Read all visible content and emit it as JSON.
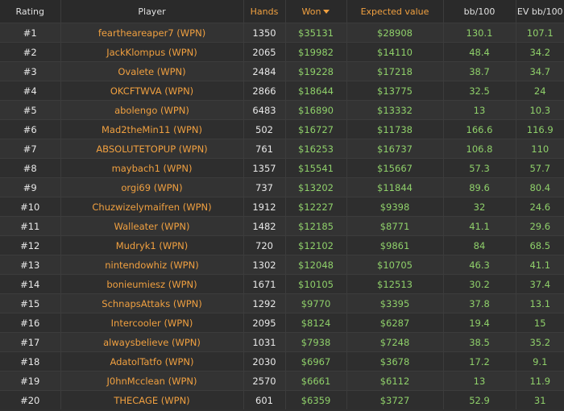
{
  "headers": {
    "rating": "Rating",
    "player": "Player",
    "hands": "Hands",
    "won": "Won",
    "expected": "Expected value",
    "bb100": "bb/100",
    "evbb100": "EV bb/100"
  },
  "colors": {
    "accent": "#f0a040",
    "positive": "#8fd06a",
    "background": "#303030"
  },
  "sort": {
    "column": "won",
    "direction": "desc",
    "icon": "caret-down-icon"
  },
  "rows": [
    {
      "rating": "#1",
      "player": "feartheareaper7 (WPN)",
      "hands": "1350",
      "won": "$35131",
      "expected": "$28908",
      "bb100": "130.1",
      "evbb100": "107.1"
    },
    {
      "rating": "#2",
      "player": "JackKlompus (WPN)",
      "hands": "2065",
      "won": "$19982",
      "expected": "$14110",
      "bb100": "48.4",
      "evbb100": "34.2"
    },
    {
      "rating": "#3",
      "player": "Ovalete (WPN)",
      "hands": "2484",
      "won": "$19228",
      "expected": "$17218",
      "bb100": "38.7",
      "evbb100": "34.7"
    },
    {
      "rating": "#4",
      "player": "OKCFTWVA (WPN)",
      "hands": "2866",
      "won": "$18644",
      "expected": "$13775",
      "bb100": "32.5",
      "evbb100": "24"
    },
    {
      "rating": "#5",
      "player": "abolengo (WPN)",
      "hands": "6483",
      "won": "$16890",
      "expected": "$13332",
      "bb100": "13",
      "evbb100": "10.3"
    },
    {
      "rating": "#6",
      "player": "Mad2theMin11 (WPN)",
      "hands": "502",
      "won": "$16727",
      "expected": "$11738",
      "bb100": "166.6",
      "evbb100": "116.9"
    },
    {
      "rating": "#7",
      "player": "ABSOLUTETOPUP (WPN)",
      "hands": "761",
      "won": "$16253",
      "expected": "$16737",
      "bb100": "106.8",
      "evbb100": "110"
    },
    {
      "rating": "#8",
      "player": "maybach1 (WPN)",
      "hands": "1357",
      "won": "$15541",
      "expected": "$15667",
      "bb100": "57.3",
      "evbb100": "57.7"
    },
    {
      "rating": "#9",
      "player": "orgi69 (WPN)",
      "hands": "737",
      "won": "$13202",
      "expected": "$11844",
      "bb100": "89.6",
      "evbb100": "80.4"
    },
    {
      "rating": "#10",
      "player": "Chuzwizelymaifren (WPN)",
      "hands": "1912",
      "won": "$12227",
      "expected": "$9398",
      "bb100": "32",
      "evbb100": "24.6"
    },
    {
      "rating": "#11",
      "player": "Walleater (WPN)",
      "hands": "1482",
      "won": "$12185",
      "expected": "$8771",
      "bb100": "41.1",
      "evbb100": "29.6"
    },
    {
      "rating": "#12",
      "player": "Mudryk1 (WPN)",
      "hands": "720",
      "won": "$12102",
      "expected": "$9861",
      "bb100": "84",
      "evbb100": "68.5"
    },
    {
      "rating": "#13",
      "player": "nintendowhiz (WPN)",
      "hands": "1302",
      "won": "$12048",
      "expected": "$10705",
      "bb100": "46.3",
      "evbb100": "41.1"
    },
    {
      "rating": "#14",
      "player": "bonieumiesz (WPN)",
      "hands": "1671",
      "won": "$10105",
      "expected": "$12513",
      "bb100": "30.2",
      "evbb100": "37.4"
    },
    {
      "rating": "#15",
      "player": "SchnapsAttaks (WPN)",
      "hands": "1292",
      "won": "$9770",
      "expected": "$3395",
      "bb100": "37.8",
      "evbb100": "13.1"
    },
    {
      "rating": "#16",
      "player": "Intercooler (WPN)",
      "hands": "2095",
      "won": "$8124",
      "expected": "$6287",
      "bb100": "19.4",
      "evbb100": "15"
    },
    {
      "rating": "#17",
      "player": "alwaysbelieve (WPN)",
      "hands": "1031",
      "won": "$7938",
      "expected": "$7248",
      "bb100": "38.5",
      "evbb100": "35.2"
    },
    {
      "rating": "#18",
      "player": "AdatolTatfo (WPN)",
      "hands": "2030",
      "won": "$6967",
      "expected": "$3678",
      "bb100": "17.2",
      "evbb100": "9.1"
    },
    {
      "rating": "#19",
      "player": "J0hnMcclean (WPN)",
      "hands": "2570",
      "won": "$6661",
      "expected": "$6112",
      "bb100": "13",
      "evbb100": "11.9"
    },
    {
      "rating": "#20",
      "player": "THECAGE (WPN)",
      "hands": "601",
      "won": "$6359",
      "expected": "$3727",
      "bb100": "52.9",
      "evbb100": "31"
    }
  ]
}
